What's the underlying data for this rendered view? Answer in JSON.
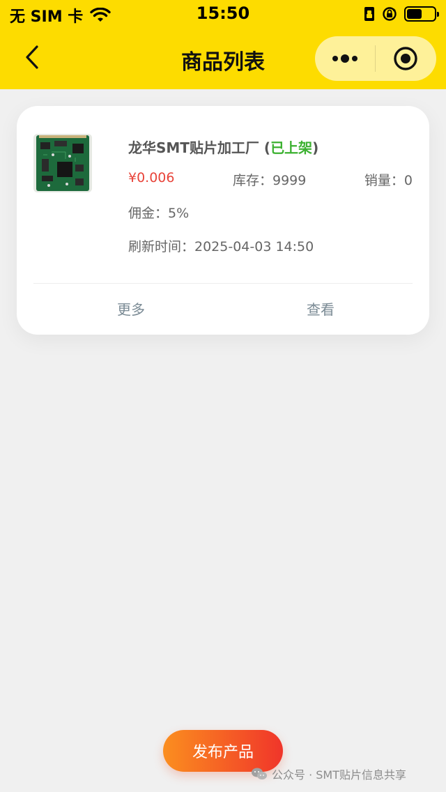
{
  "status_bar": {
    "carrier": "无 SIM 卡",
    "time": "15:50"
  },
  "nav": {
    "title": "商品列表"
  },
  "product": {
    "name": "龙华SMT贴片加工厂",
    "status_open": " (",
    "status": "已上架",
    "status_close": ")",
    "price": "¥0.006",
    "stock": "库存：9999",
    "sales": "销量：0",
    "commission": "佣金：5%",
    "refresh_time": "刷新时间：2025-04-03 14:50",
    "actions": {
      "more": "更多",
      "view": "查看"
    }
  },
  "publish_button": "发布产品",
  "watermark": "公众号 · SMT贴片信息共享",
  "colors": {
    "header": "#fddc00",
    "price": "#e8443a",
    "status_on": "#3cb131",
    "publish_start": "#fb8e1f",
    "publish_end": "#f0352a"
  }
}
